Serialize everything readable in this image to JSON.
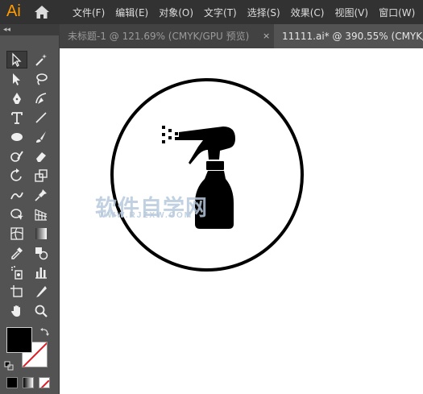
{
  "app": {
    "logo": "Ai"
  },
  "menu": [
    "文件(F)",
    "编辑(E)",
    "对象(O)",
    "文字(T)",
    "选择(S)",
    "效果(C)",
    "视图(V)",
    "窗口(W)"
  ],
  "toolbar": {
    "collapse_label": "◂◂"
  },
  "tabs": [
    {
      "label": "未标题-1 @ 121.69% (CMYK/GPU 预览)",
      "close": "×"
    },
    {
      "label": "11111.ai* @ 390.55% (CMYK/",
      "close": ""
    }
  ],
  "watermark": {
    "main": "软件自学网",
    "sub": "WWW.RJZXW.COM"
  },
  "colors": {
    "fill": "#000000",
    "stroke": "none"
  }
}
